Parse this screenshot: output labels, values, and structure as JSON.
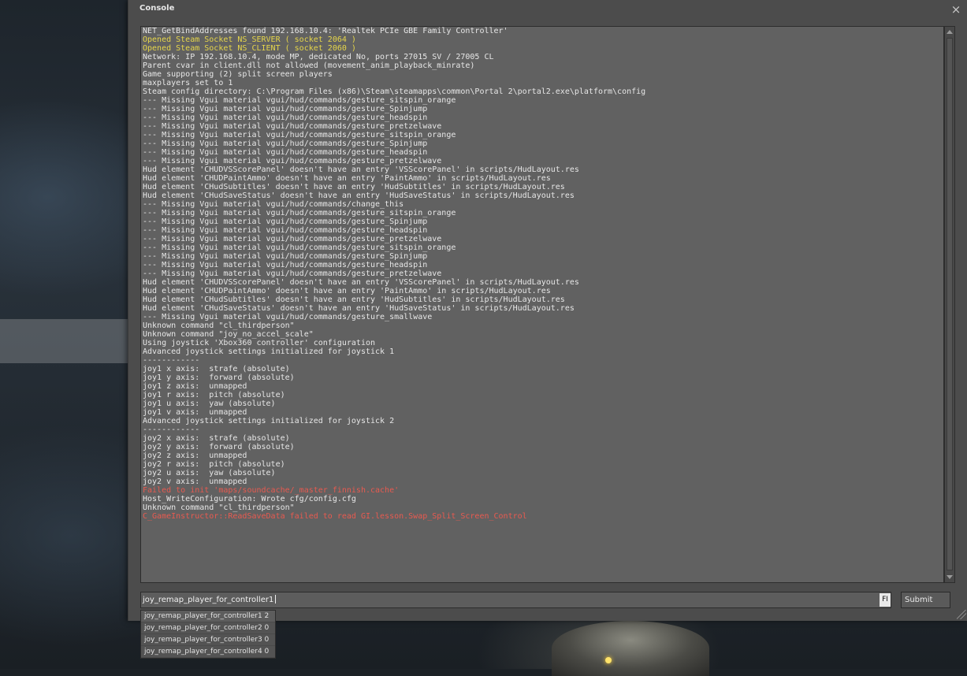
{
  "window": {
    "title": "Console",
    "close_glyph": "×"
  },
  "log": [
    {
      "text": "NET_GetBindAddresses found 192.168.10.4: 'Realtek PCIe GBE Family Controller'",
      "color": "default"
    },
    {
      "text": "Opened Steam Socket NS_SERVER ( socket 2064 )",
      "color": "yellow"
    },
    {
      "text": "Opened Steam Socket NS_CLIENT ( socket 2060 )",
      "color": "yellow"
    },
    {
      "text": "Network: IP 192.168.10.4, mode MP, dedicated No, ports 27015 SV / 27005 CL",
      "color": "default"
    },
    {
      "text": "Parent cvar in client.dll not allowed (movement_anim_playback_minrate)",
      "color": "default"
    },
    {
      "text": "Game supporting (2) split screen players",
      "color": "default"
    },
    {
      "text": "maxplayers set to 1",
      "color": "default"
    },
    {
      "text": "Steam config directory: C:\\Program Files (x86)\\Steam\\steamapps\\common\\Portal 2\\portal2.exe\\platform\\config",
      "color": "default"
    },
    {
      "text": "--- Missing Vgui material vgui/hud/commands/gesture_sitspin_orange",
      "color": "default"
    },
    {
      "text": "--- Missing Vgui material vgui/hud/commands/gesture_Spinjump",
      "color": "default"
    },
    {
      "text": "--- Missing Vgui material vgui/hud/commands/gesture_headspin",
      "color": "default"
    },
    {
      "text": "--- Missing Vgui material vgui/hud/commands/gesture_pretzelwave",
      "color": "default"
    },
    {
      "text": "--- Missing Vgui material vgui/hud/commands/gesture_sitspin_orange",
      "color": "default"
    },
    {
      "text": "--- Missing Vgui material vgui/hud/commands/gesture_Spinjump",
      "color": "default"
    },
    {
      "text": "--- Missing Vgui material vgui/hud/commands/gesture_headspin",
      "color": "default"
    },
    {
      "text": "--- Missing Vgui material vgui/hud/commands/gesture_pretzelwave",
      "color": "default"
    },
    {
      "text": "Hud element 'CHUDVSScorePanel' doesn't have an entry 'VSScorePanel' in scripts/HudLayout.res",
      "color": "default"
    },
    {
      "text": "Hud element 'CHUDPaintAmmo' doesn't have an entry 'PaintAmmo' in scripts/HudLayout.res",
      "color": "default"
    },
    {
      "text": "Hud element 'CHudSubtitles' doesn't have an entry 'HudSubtitles' in scripts/HudLayout.res",
      "color": "default"
    },
    {
      "text": "Hud element 'CHudSaveStatus' doesn't have an entry 'HudSaveStatus' in scripts/HudLayout.res",
      "color": "default"
    },
    {
      "text": "--- Missing Vgui material vgui/hud/commands/change_this",
      "color": "default"
    },
    {
      "text": "--- Missing Vgui material vgui/hud/commands/gesture_sitspin_orange",
      "color": "default"
    },
    {
      "text": "--- Missing Vgui material vgui/hud/commands/gesture_Spinjump",
      "color": "default"
    },
    {
      "text": "--- Missing Vgui material vgui/hud/commands/gesture_headspin",
      "color": "default"
    },
    {
      "text": "--- Missing Vgui material vgui/hud/commands/gesture_pretzelwave",
      "color": "default"
    },
    {
      "text": "--- Missing Vgui material vgui/hud/commands/gesture_sitspin_orange",
      "color": "default"
    },
    {
      "text": "--- Missing Vgui material vgui/hud/commands/gesture_Spinjump",
      "color": "default"
    },
    {
      "text": "--- Missing Vgui material vgui/hud/commands/gesture_headspin",
      "color": "default"
    },
    {
      "text": "--- Missing Vgui material vgui/hud/commands/gesture_pretzelwave",
      "color": "default"
    },
    {
      "text": "Hud element 'CHUDVSScorePanel' doesn't have an entry 'VSScorePanel' in scripts/HudLayout.res",
      "color": "default"
    },
    {
      "text": "Hud element 'CHUDPaintAmmo' doesn't have an entry 'PaintAmmo' in scripts/HudLayout.res",
      "color": "default"
    },
    {
      "text": "Hud element 'CHudSubtitles' doesn't have an entry 'HudSubtitles' in scripts/HudLayout.res",
      "color": "default"
    },
    {
      "text": "Hud element 'CHudSaveStatus' doesn't have an entry 'HudSaveStatus' in scripts/HudLayout.res",
      "color": "default"
    },
    {
      "text": "--- Missing Vgui material vgui/hud/commands/gesture_smallwave",
      "color": "default"
    },
    {
      "text": "Unknown command \"cl_thirdperson\"",
      "color": "default"
    },
    {
      "text": "Unknown command \"joy_no_accel_scale\"",
      "color": "default"
    },
    {
      "text": "Using joystick 'Xbox360 controller' configuration",
      "color": "default"
    },
    {
      "text": "Advanced joystick settings initialized for joystick 1",
      "color": "default"
    },
    {
      "text": "------------",
      "color": "default"
    },
    {
      "text": "joy1 x axis:  strafe (absolute)",
      "color": "default"
    },
    {
      "text": "joy1 y axis:  forward (absolute)",
      "color": "default"
    },
    {
      "text": "joy1 z axis:  unmapped",
      "color": "default"
    },
    {
      "text": "joy1 r axis:  pitch (absolute)",
      "color": "default"
    },
    {
      "text": "joy1 u axis:  yaw (absolute)",
      "color": "default"
    },
    {
      "text": "joy1 v axis:  unmapped",
      "color": "default"
    },
    {
      "text": "Advanced joystick settings initialized for joystick 2",
      "color": "default"
    },
    {
      "text": "------------",
      "color": "default"
    },
    {
      "text": "joy2 x axis:  strafe (absolute)",
      "color": "default"
    },
    {
      "text": "joy2 y axis:  forward (absolute)",
      "color": "default"
    },
    {
      "text": "joy2 z axis:  unmapped",
      "color": "default"
    },
    {
      "text": "joy2 r axis:  pitch (absolute)",
      "color": "default"
    },
    {
      "text": "joy2 u axis:  yaw (absolute)",
      "color": "default"
    },
    {
      "text": "joy2 v axis:  unmapped",
      "color": "default"
    },
    {
      "text": "Failed to init 'maps/soundcache/_master_finnish.cache'",
      "color": "red"
    },
    {
      "text": "Host_WriteConfiguration: Wrote cfg/config.cfg",
      "color": "default"
    },
    {
      "text": "Unknown command \"cl_thirdperson\"",
      "color": "default"
    },
    {
      "text": "C_GameInstructor::ReadSaveData failed to read GI.lesson.Swap_Split_Screen_Control",
      "color": "red"
    }
  ],
  "input": {
    "value": "joy_remap_player_for_controller1",
    "language_badge": "FI"
  },
  "submit_label": "Submit",
  "completions": [
    "joy_remap_player_for_controller1 2",
    "joy_remap_player_for_controller2 0",
    "joy_remap_player_for_controller3 0",
    "joy_remap_player_for_controller4 0"
  ],
  "colors": {
    "log_default": "#e7e7e7",
    "log_warning": "#e6d64a",
    "log_error": "#e85a50",
    "panel": "#4c4c4c",
    "log_background": "#616161"
  }
}
